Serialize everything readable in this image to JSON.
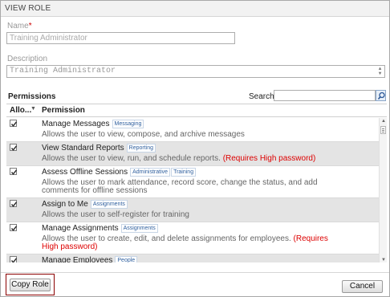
{
  "title": "VIEW ROLE",
  "name_label": "Name",
  "required_mark": "*",
  "name_value": "Training Administrator",
  "description_label": "Description",
  "description_value": "Training Administrator",
  "permissions_label": "Permissions",
  "search_label": "Search:",
  "search_value": "",
  "columns": {
    "allow": "Allo...",
    "permission": "Permission"
  },
  "rows": [
    {
      "title": "Manage Messages",
      "tags": [
        "Messaging"
      ],
      "description": "Allows the user to view, compose, and archive messages",
      "warning": "",
      "checked": true
    },
    {
      "title": "View Standard Reports",
      "tags": [
        "Reporting"
      ],
      "description": "Allows the user to view, run, and schedule reports.",
      "warning": "(Requires High password)",
      "checked": true
    },
    {
      "title": "Assess Offline Sessions",
      "tags": [
        "Administrative",
        "Training"
      ],
      "description": "Allows the user to mark attendance, record score, change the status, and add comments for offline sessions",
      "warning": "",
      "checked": true
    },
    {
      "title": "Assign to Me",
      "tags": [
        "Assignments"
      ],
      "description": "Allows the user to self-register for training",
      "warning": "",
      "checked": true
    },
    {
      "title": "Manage Assignments",
      "tags": [
        "Assignments"
      ],
      "description": "Allows the user to create, edit, and delete assignments for employees.",
      "warning": "(Requires High password)",
      "checked": true
    },
    {
      "title": "Manage Employees",
      "tags": [
        "People"
      ],
      "description": "",
      "warning": "",
      "checked": true
    }
  ],
  "buttons": {
    "copy_role": "Copy Role",
    "cancel": "Cancel"
  },
  "icons": {
    "search": "magnifier-icon",
    "checkbox": "checkmark-icon"
  },
  "colors": {
    "warning": "#dd0000",
    "tag_text": "#2e5f9e",
    "alt_row": "#e4e4e4",
    "focus_border": "#8b0000"
  }
}
